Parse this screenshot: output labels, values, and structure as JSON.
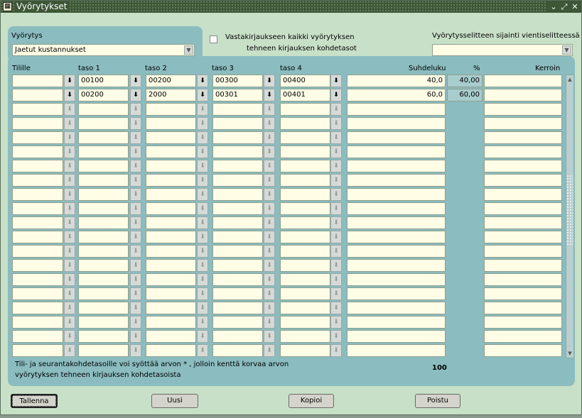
{
  "window": {
    "title": "Vyörytykset",
    "icon": "app-icon",
    "buttons": [
      "minimize-icon",
      "maximize-icon",
      "close-icon"
    ]
  },
  "allocation": {
    "label": "Vyörytys",
    "value": "Jaetut kustannukset"
  },
  "counter_entry": {
    "label_line1": "Vastakirjaukseen kaikki vyörytyksen",
    "label_line2": "tehneen kirjauksen kohdetasot",
    "checked": false
  },
  "description_position": {
    "label": "Vyörytysselitteen sijainti vientiselitteessä",
    "value": ""
  },
  "columns": {
    "account": "Tilille",
    "level1": "taso 1",
    "level2": "taso 2",
    "level3": "taso 3",
    "level4": "taso 4",
    "ratio": "Suhdeluku",
    "percent": "%",
    "factor": "Kerroin"
  },
  "rows": [
    {
      "account": "",
      "level1": "00100",
      "level2": "00200",
      "level3": "00300",
      "level4": "00400",
      "ratio": "40,0",
      "percent": "40,00",
      "factor": ""
    },
    {
      "account": "",
      "level1": "00200",
      "level2": "2000",
      "level3": "00301",
      "level4": "00401",
      "ratio": "60,0",
      "percent": "60,00",
      "factor": ""
    },
    {},
    {},
    {},
    {},
    {},
    {},
    {},
    {},
    {},
    {},
    {},
    {},
    {},
    {},
    {},
    {},
    {},
    {}
  ],
  "note": {
    "line1": "Tili- ja seurantakohdetasoille voi syöttää arvon * , jolloin kenttä korvaa arvon",
    "line2": "vyörytyksen tehneen kirjauksen kohdetasoista"
  },
  "total_percent": "100",
  "buttons": {
    "save": "Tallenna",
    "new": "Uusi",
    "copy": "Kopioi",
    "exit": "Poistu"
  }
}
